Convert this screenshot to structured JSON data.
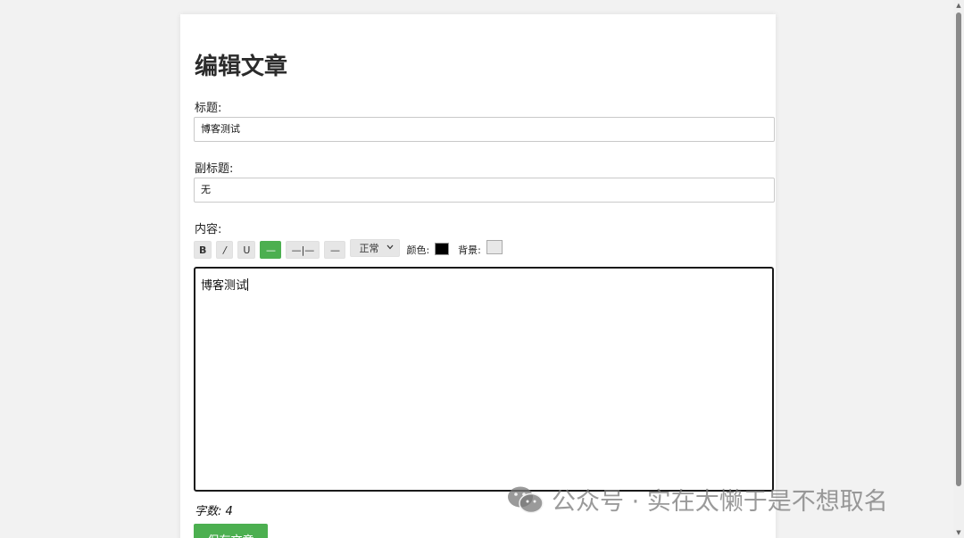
{
  "page": {
    "title": "编辑文章"
  },
  "form": {
    "title_label": "标题:",
    "title_value": "博客测试",
    "subtitle_label": "副标题:",
    "subtitle_value": "无",
    "content_label": "内容:",
    "content_value": "博客测试"
  },
  "toolbar": {
    "bold": "B",
    "italic": "/",
    "underline": "U",
    "hr": "—",
    "split": "—|—",
    "line": "—",
    "format_select": "正常",
    "color_label": "颜色:",
    "text_color": "#000000",
    "bg_label": "背景:",
    "bg_color": "#e8e8e8"
  },
  "footer": {
    "word_count": "字数: 4",
    "save_button": "保存文章"
  },
  "watermark": {
    "text": "公众号 · 实在太懒于是不想取名"
  },
  "colors": {
    "accent": "#4caf50",
    "page_bg": "#f2f2f2"
  }
}
